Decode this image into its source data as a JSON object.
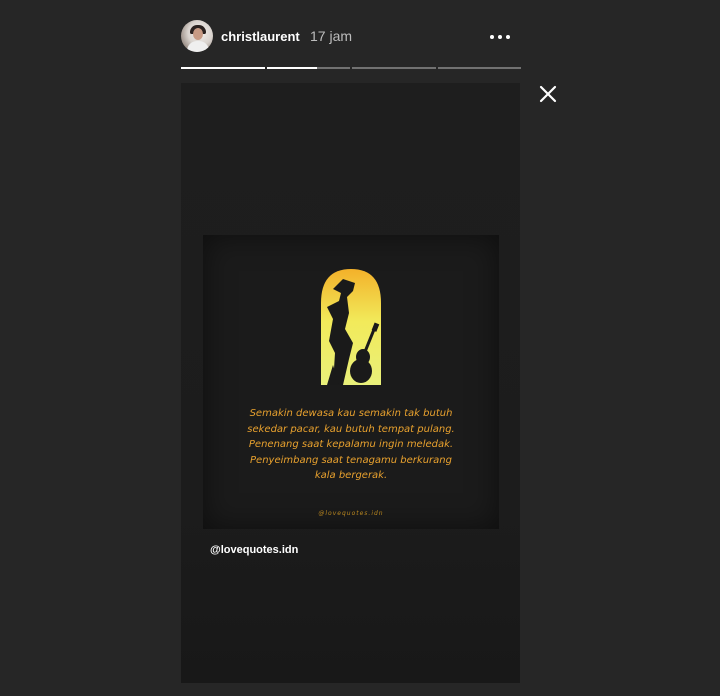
{
  "header": {
    "username": "christlaurent",
    "timestamp": "17 jam",
    "more_icon": "more-horizontal-icon"
  },
  "progress": {
    "segments": [
      {
        "state": "viewed",
        "fill": 1.0
      },
      {
        "state": "current",
        "fill": 0.6
      },
      {
        "state": "unseen",
        "fill": 0.0
      },
      {
        "state": "unseen",
        "fill": 0.0
      }
    ]
  },
  "close_icon": "close-icon",
  "story": {
    "quote_lines": [
      "Semakin dewasa kau semakin tak butuh",
      "sekedar pacar, kau butuh tempat pulang.",
      "Penenang saat kepalamu ingin meledak.",
      "Penyeimbang saat tenagamu berkurang",
      "kala bergerak."
    ],
    "watermark": "@lovequotes.idn",
    "mention": "@lovequotes.idn"
  },
  "colors": {
    "background": "#262626",
    "quote_text": "#e8a12e",
    "progress_active": "#ffffff",
    "progress_inactive": "#7a7a7a"
  }
}
